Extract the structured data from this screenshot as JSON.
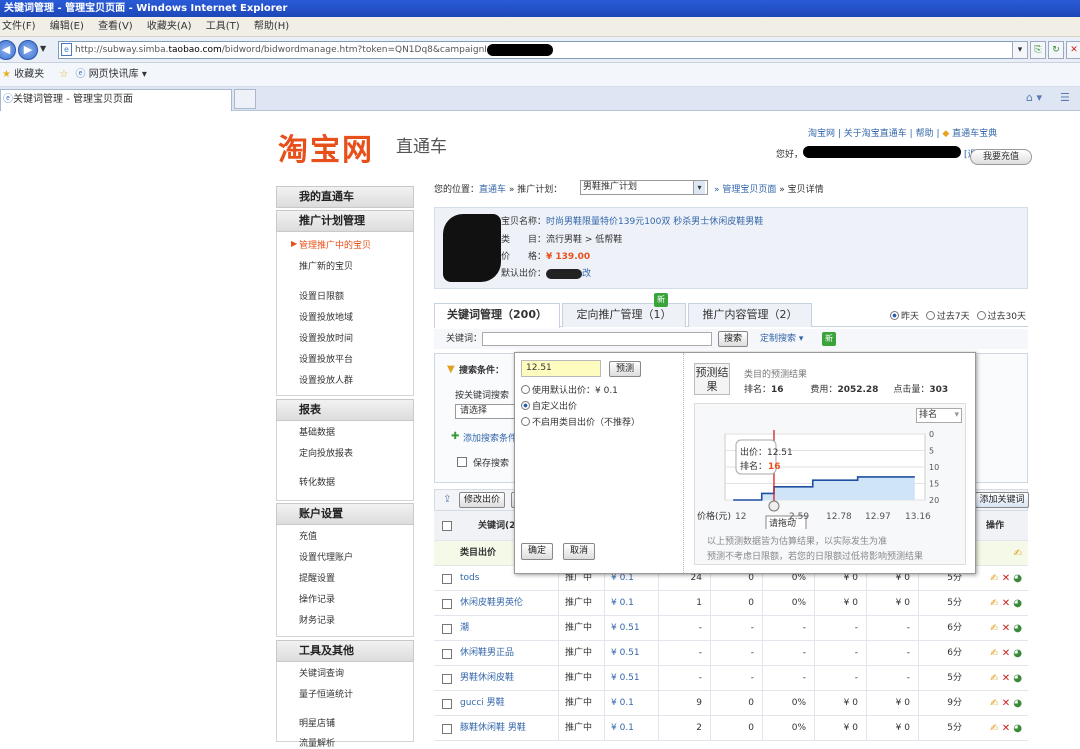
{
  "window": {
    "title": "关键词管理 - 管理宝贝页面 - Windows Internet Explorer"
  },
  "menu": [
    "文件(F)",
    "编辑(E)",
    "查看(V)",
    "收藏夹(A)",
    "工具(T)",
    "帮助(H)"
  ],
  "address": {
    "prefix": "http://subway.simba.",
    "domain": "taobao.com",
    "path": "/bidword/bidwordmanage.htm?token=QN1Dq8&campaignId"
  },
  "favorites": {
    "label": "收藏夹",
    "item": "网页快讯库 ▾"
  },
  "tab": {
    "label": "关键词管理 - 管理宝贝页面"
  },
  "header": {
    "logo": "淘宝网",
    "logo_sub": "直通车",
    "links": [
      "淘宝网",
      "关于淘宝直通车",
      "帮助",
      "直通车宝典"
    ],
    "hello": "您好，",
    "logout": "[退出]",
    "recharge": "我要充值"
  },
  "sidebar": {
    "sections": [
      {
        "title": "我的直通车",
        "items": []
      },
      {
        "title": "推广计划管理",
        "items": [
          "管理推广中的宝贝",
          "推广新的宝贝",
          "设置日限额",
          "设置投放地域",
          "设置投放时间",
          "设置投放平台",
          "设置投放人群"
        ]
      },
      {
        "title": "报表",
        "items": [
          "基础数据",
          "定向投放报表",
          "转化数据"
        ]
      },
      {
        "title": "账户设置",
        "items": [
          "充值",
          "设置代理账户",
          "提醒设置",
          "操作记录",
          "财务记录"
        ]
      },
      {
        "title": "工具及其他",
        "items": [
          "关键词查询",
          "量子恒道统计",
          "明星店铺",
          "流量解析"
        ]
      }
    ]
  },
  "breadcrumb": {
    "position": "您的位置：",
    "home": "直通车",
    "plan_label": "» 推广计划：",
    "plan": "男鞋推广计划",
    "manage": "» 管理宝贝页面",
    "detail": "» 宝贝详情"
  },
  "product": {
    "name_label": "宝贝名称：",
    "name": "时尚男鞋限量特价139元100双 秒杀男士休闲皮鞋男鞋",
    "cat_label": "类　　目：",
    "cat": "流行男鞋 > 低帮鞋",
    "price_label": "价　　格：",
    "price": "¥ 139.00",
    "default_bid_label": "默认出价：",
    "edit": "改"
  },
  "tabs": [
    {
      "label": "关键词管理（200）"
    },
    {
      "label": "定向推广管理（1）"
    },
    {
      "label": "推广内容管理（2）"
    }
  ],
  "new_badge": "新",
  "periods": [
    "昨天",
    "过去7天",
    "过去30天"
  ],
  "kwbar": {
    "label": "关键词：",
    "search": "搜索",
    "custom": "定制搜索"
  },
  "filter": {
    "label": "搜索条件：",
    "by": "按关键词搜索",
    "select": "请选择",
    "add": "添加搜索条件",
    "save": "保存搜索"
  },
  "tablebar": {
    "edit_bid": "修改出价",
    "add_keyword": "添加关键词"
  },
  "table": {
    "header_keyword": "关键词(2",
    "header_ops": "操作",
    "cat_row": "类目出价",
    "rows": [
      {
        "kw": "tods",
        "status": "推广中",
        "bid": "¥ 0.1",
        "imp": "24",
        "clk": "0",
        "ctr": "0%",
        "cost": "¥ 0",
        "cpc": "¥ 0",
        "score": "5分"
      },
      {
        "kw": "休闲皮鞋男英伦",
        "status": "推广中",
        "bid": "¥ 0.1",
        "imp": "1",
        "clk": "0",
        "ctr": "0%",
        "cost": "¥ 0",
        "cpc": "¥ 0",
        "score": "5分"
      },
      {
        "kw": "潮",
        "status": "推广中",
        "bid": "¥ 0.51",
        "imp": "-",
        "clk": "-",
        "ctr": "-",
        "cost": "-",
        "cpc": "-",
        "score": "6分"
      },
      {
        "kw": "休闲鞋男正品",
        "status": "推广中",
        "bid": "¥ 0.51",
        "imp": "-",
        "clk": "-",
        "ctr": "-",
        "cost": "-",
        "cpc": "-",
        "score": "6分"
      },
      {
        "kw": "男鞋休闲皮鞋",
        "status": "推广中",
        "bid": "¥ 0.51",
        "imp": "-",
        "clk": "-",
        "ctr": "-",
        "cost": "-",
        "cpc": "-",
        "score": "5分"
      },
      {
        "kw": "gucci 男鞋",
        "status": "推广中",
        "bid": "¥ 0.1",
        "imp": "9",
        "clk": "0",
        "ctr": "0%",
        "cost": "¥ 0",
        "cpc": "¥ 0",
        "score": "9分"
      },
      {
        "kw": "豚鞋休闲鞋 男鞋",
        "status": "推广中",
        "bid": "¥ 0.1",
        "imp": "2",
        "clk": "0",
        "ctr": "0%",
        "cost": "¥ 0",
        "cpc": "¥ 0",
        "score": "5分"
      }
    ]
  },
  "modal": {
    "bid_value": "12.51",
    "predict": "预测",
    "opt_default": "使用默认出价：¥ 0.1",
    "opt_custom": "自定义出价",
    "opt_disable": "不启用类目出价（不推荐）",
    "ok": "确定",
    "cancel": "取消",
    "pred_tag": "预测结果",
    "pred_title": "类目的预测结果",
    "rank_label": "排名：",
    "rank": "16",
    "cost_label": "费用：",
    "cost": "2052.28",
    "clicks_label": "点击量：",
    "clicks": "303",
    "rank_select": "排名",
    "note1": "以上预测数据皆为估算结果，以实际发生为准",
    "note2": "预测不考虑日限额，若您的日限额过低将影响预测结果"
  },
  "chart_data": {
    "type": "area",
    "xlabel": "价格(元)",
    "x_ticks": [
      "12",
      "2.59",
      "12.78",
      "12.97",
      "13.16"
    ],
    "y_ticks": [
      "0",
      "5",
      "10",
      "15",
      "20"
    ],
    "y_inverted": true,
    "tooltip": {
      "bid_label": "出价：",
      "bid": "12.51",
      "rank_label": "排名：",
      "rank": "16"
    },
    "drag_hint": "请拖动",
    "steps": [
      {
        "x": 12.31,
        "y": 20
      },
      {
        "x": 12.45,
        "y": 18
      },
      {
        "x": 12.51,
        "y": 16
      },
      {
        "x": 12.7,
        "y": 14
      },
      {
        "x": 12.92,
        "y": 13
      },
      {
        "x": 13.2,
        "y": 13
      }
    ]
  }
}
